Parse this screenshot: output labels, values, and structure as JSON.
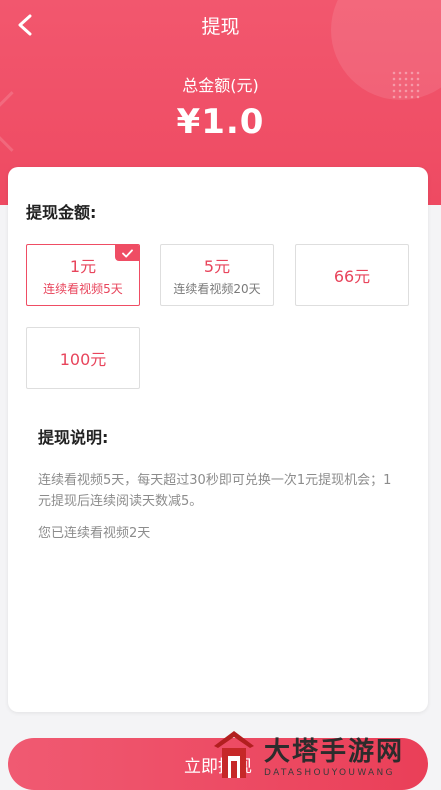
{
  "header": {
    "title": "提现",
    "total_label": "总金额(元)",
    "total_amount": "¥1.0"
  },
  "withdraw": {
    "section_title": "提现金额:",
    "options": [
      {
        "amount": "1元",
        "condition": "连续看视频5天",
        "selected": true
      },
      {
        "amount": "5元",
        "condition": "连续看视频20天",
        "selected": false
      },
      {
        "amount": "66元",
        "condition": "",
        "selected": false
      },
      {
        "amount": "100元",
        "condition": "",
        "selected": false
      }
    ]
  },
  "instructions": {
    "section_title": "提现说明:",
    "text1": "连续看视频5天，每天超过30秒即可兑换一次1元提现机会；1元提现后连续阅读天数减5。",
    "text2": "您已连续看视频2天"
  },
  "submit": {
    "label": "立即提现"
  },
  "watermark": {
    "main": "大塔手游网",
    "sub": "DATASHOUYOUWANG"
  },
  "colors": {
    "brand": "#ef4d64",
    "text_muted": "#8c8c8c"
  },
  "icons": {
    "back": "chevron-left-icon",
    "check": "check-icon",
    "logo": "tower-logo-icon"
  }
}
